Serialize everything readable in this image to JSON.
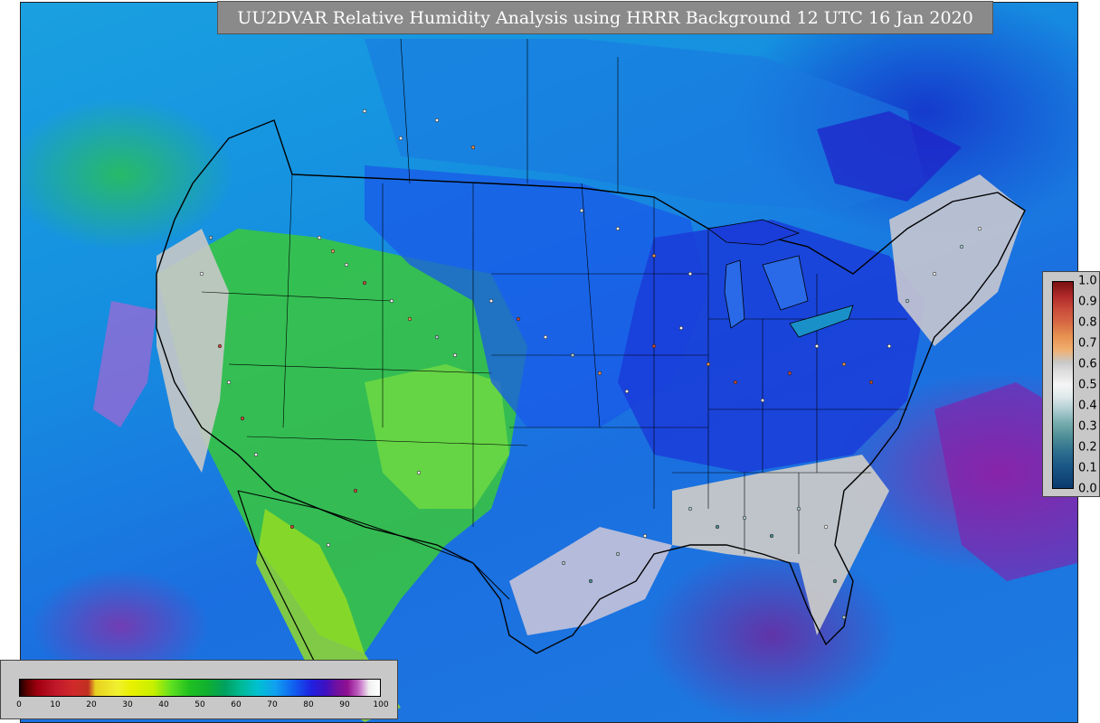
{
  "title": "UU2DVAR Relative Humidity Analysis using HRRR Background 12 UTC 16 Jan 2020",
  "humidity_colorbar": {
    "ticks": [
      "0",
      "10",
      "20",
      "30",
      "40",
      "50",
      "60",
      "70",
      "80",
      "90",
      "100"
    ]
  },
  "ratio_colorbar": {
    "ticks": [
      "1.0",
      "0.9",
      "0.8",
      "0.7",
      "0.6",
      "0.5",
      "0.4",
      "0.3",
      "0.2",
      "0.1",
      "0.0"
    ]
  },
  "colors": {
    "ocean": "#1a8fe0",
    "dry": "#40d020",
    "moist": "#1a3ce0",
    "saturated": "#c8c8c8",
    "border": "#000000"
  }
}
